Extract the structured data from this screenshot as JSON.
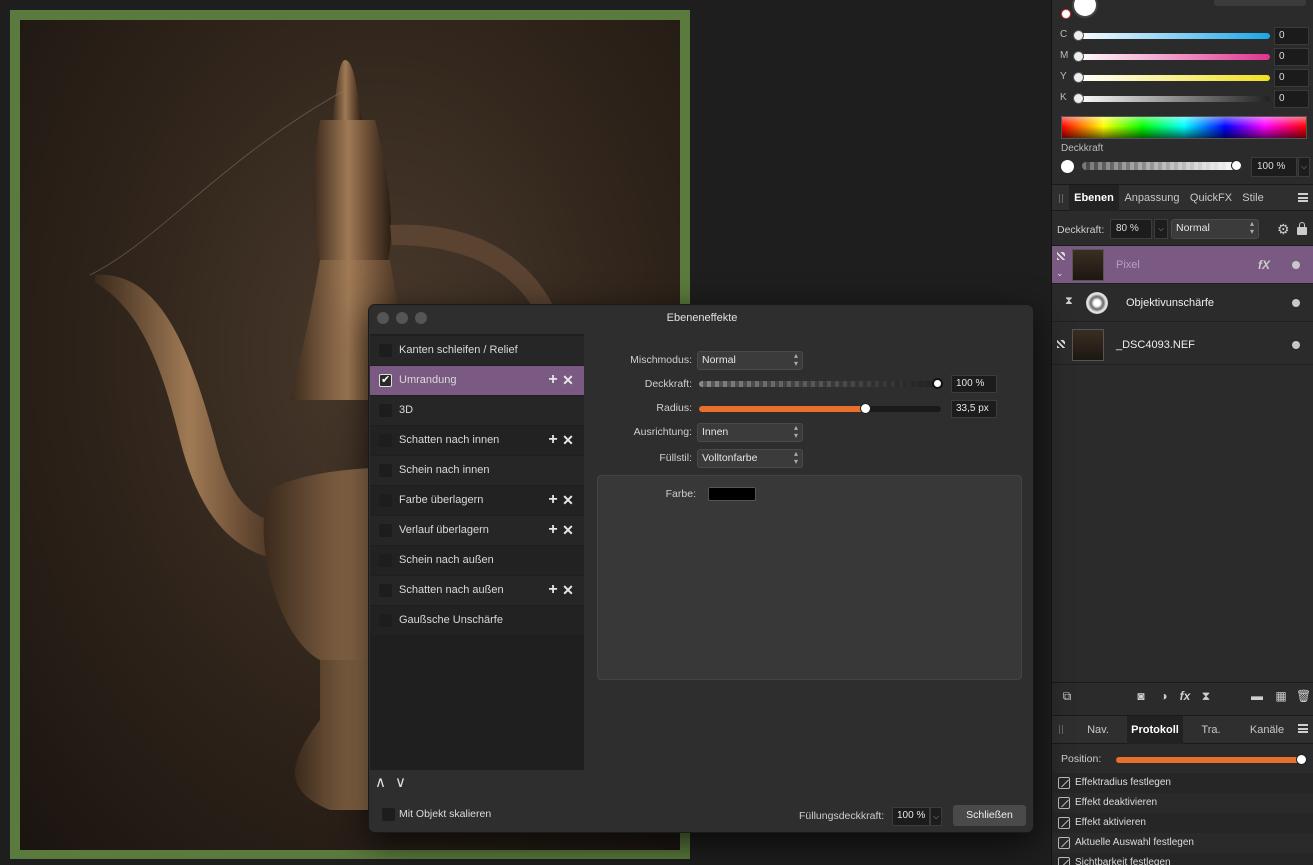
{
  "colors": {
    "accent_purple": "#7a5a82",
    "orange": "#e8702a",
    "canvas_frame_green": "#5b7a3d"
  },
  "color_panel": {
    "channels": [
      {
        "letter": "C",
        "value": "0",
        "color": "#1aa6e8"
      },
      {
        "letter": "M",
        "value": "0",
        "color": "#e0338f"
      },
      {
        "letter": "Y",
        "value": "0",
        "color": "#f0e020"
      },
      {
        "letter": "K",
        "value": "0",
        "color": "#222222"
      }
    ],
    "opacity_label": "Deckkraft",
    "opacity_value": "100 %"
  },
  "layers_panel": {
    "tabs": [
      "Ebenen",
      "Anpassung",
      "QuickFX",
      "Stile"
    ],
    "opacity_label": "Deckkraft:",
    "opacity_value": "80 %",
    "blend_mode": "Normal",
    "layers": [
      {
        "name": "Pixel",
        "fx": "fX"
      },
      {
        "name": "Objektivunschärfe"
      },
      {
        "name": "_DSC4093.NEF"
      }
    ]
  },
  "history_panel": {
    "tabs": [
      "Nav.",
      "Protokoll",
      "Tra.",
      "Kanäle"
    ],
    "position_label": "Position:",
    "items": [
      "Effektradius festlegen",
      "Effekt deaktivieren",
      "Effekt aktivieren",
      "Aktuelle Auswahl festlegen",
      "Sichtbarkeit festlegen"
    ]
  },
  "dialog": {
    "title": "Ebeneneffekte",
    "effects": [
      {
        "label": "Kanten schleifen / Relief",
        "checked": false,
        "addable": false
      },
      {
        "label": "Umrandung",
        "checked": true,
        "addable": true
      },
      {
        "label": "3D",
        "checked": false,
        "addable": false
      },
      {
        "label": "Schatten nach innen",
        "checked": false,
        "addable": true
      },
      {
        "label": "Schein nach innen",
        "checked": false,
        "addable": false
      },
      {
        "label": "Farbe überlagern",
        "checked": false,
        "addable": true
      },
      {
        "label": "Verlauf überlagern",
        "checked": false,
        "addable": true
      },
      {
        "label": "Schein nach außen",
        "checked": false,
        "addable": false
      },
      {
        "label": "Schatten nach außen",
        "checked": false,
        "addable": true
      },
      {
        "label": "Gaußsche Unschärfe",
        "checked": false,
        "addable": false
      }
    ],
    "props": {
      "blend_label": "Mischmodus:",
      "blend_value": "Normal",
      "opacity_label": "Deckkraft:",
      "opacity_value": "100 %",
      "opacity_level": 1.0,
      "radius_label": "Radius:",
      "radius_value": "33,5 px",
      "radius_level": 0.69,
      "align_label": "Ausrichtung:",
      "align_value": "Innen",
      "fill_label": "Füllstil:",
      "fill_value": "Volltonfarbe",
      "color_label": "Farbe:",
      "color_value": "#000000"
    },
    "scale_label": "Mit Objekt skalieren",
    "fill_opacity_label": "Füllungsdeckkraft:",
    "fill_opacity_value": "100 %",
    "close_button": "Schließen"
  }
}
